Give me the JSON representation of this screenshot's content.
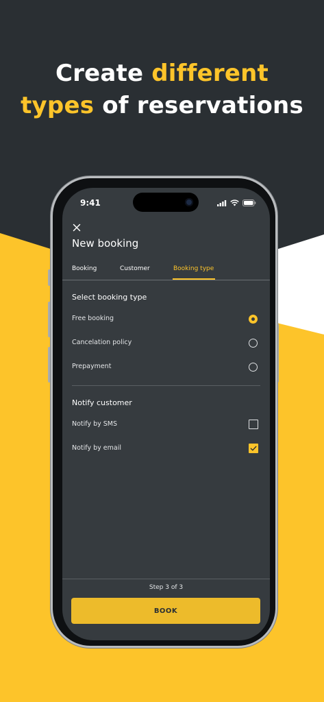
{
  "headline": {
    "line1_white": "Create ",
    "line1_yellow": "different",
    "line2_yellow": "types",
    "line2_white": " of reservations"
  },
  "status_bar": {
    "time": "9:41"
  },
  "screen": {
    "title": "New booking",
    "tabs": [
      {
        "label": "Booking",
        "active": false
      },
      {
        "label": "Customer",
        "active": false
      },
      {
        "label": "Booking type",
        "active": true
      }
    ],
    "booking_type": {
      "title": "Select booking type",
      "options": [
        {
          "label": "Free booking",
          "selected": true
        },
        {
          "label": "Cancelation policy",
          "selected": false
        },
        {
          "label": "Prepayment",
          "selected": false
        }
      ]
    },
    "notify": {
      "title": "Notify customer",
      "options": [
        {
          "label": "Notify by SMS",
          "checked": false
        },
        {
          "label": "Notify by email",
          "checked": true
        }
      ]
    },
    "step": "Step 3 of 3",
    "book_label": "BOOK"
  },
  "colors": {
    "accent": "#fdc42a",
    "background": "#2a2f33",
    "screen": "#363b3f"
  }
}
